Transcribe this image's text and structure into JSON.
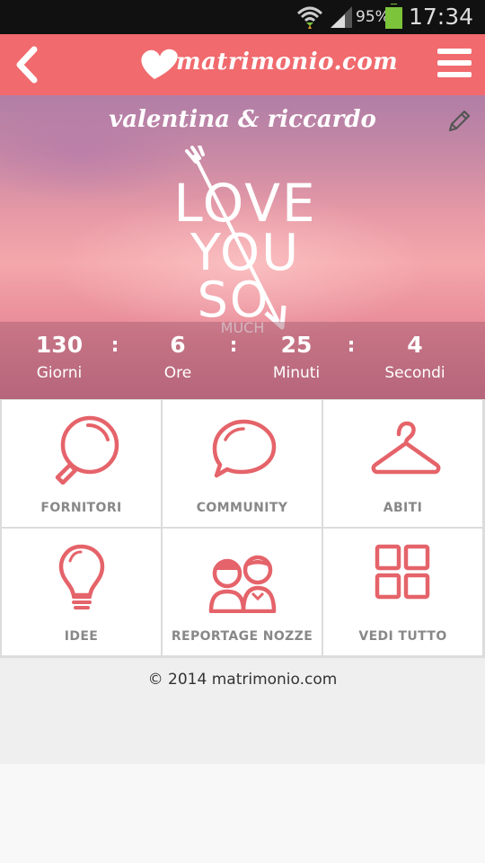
{
  "status_bar": {
    "battery_percent": "95%",
    "time": "17:34",
    "icons": [
      "wifi-icon",
      "signal-icon",
      "battery-icon"
    ]
  },
  "app_bar": {
    "logo_text": "matrimonio.com",
    "icons": [
      "back-icon",
      "heart-logo-icon",
      "menu-icon"
    ]
  },
  "hero": {
    "couple_names": "valentina & riccardo",
    "love_lines": [
      "LOVE",
      "YOU",
      "SO"
    ],
    "much_text": "MUCH",
    "icons": [
      "edit-pencil-icon",
      "arrow-icon"
    ]
  },
  "countdown": {
    "separator": ":",
    "items": [
      {
        "value": "130",
        "label": "Giorni"
      },
      {
        "value": "6",
        "label": "Ore"
      },
      {
        "value": "25",
        "label": "Minuti"
      },
      {
        "value": "4",
        "label": "Secondi"
      }
    ]
  },
  "menu_grid": {
    "items": [
      {
        "label": "FORNITORI",
        "icon": "magnifier-icon"
      },
      {
        "label": "COMMUNITY",
        "icon": "speech-bubble-icon"
      },
      {
        "label": "ABITI",
        "icon": "hanger-icon"
      },
      {
        "label": "IDEE",
        "icon": "lightbulb-icon"
      },
      {
        "label": "REPORTAGE NOZZE",
        "icon": "couple-icon"
      },
      {
        "label": "VEDI TUTTO",
        "icon": "grid-icon"
      }
    ]
  },
  "footer": {
    "copyright": "© 2014 matrimonio.com"
  },
  "colors": {
    "brand": "#f06a6e",
    "icon_accent": "#e5636a",
    "label_gray": "#888888"
  }
}
